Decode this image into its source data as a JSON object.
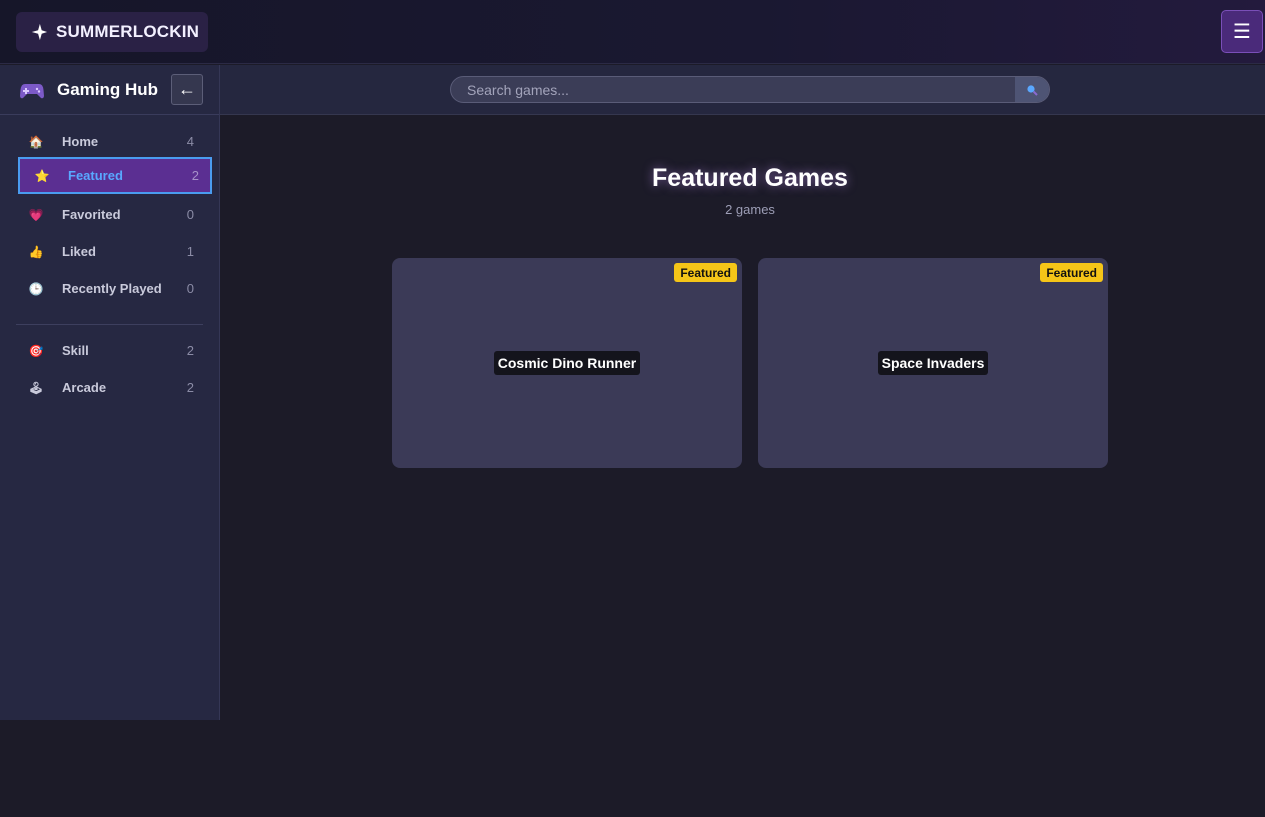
{
  "header": {
    "brand": "SUMMERLOCKIN",
    "brand_icon": "sparkle-icon",
    "menu_icon": "hamburger-icon",
    "menu_glyph": "☰"
  },
  "sidebar": {
    "title": "Gaming Hub",
    "title_icon": "gamepad-icon",
    "collapse_glyph": "←",
    "items": [
      {
        "label": "Home",
        "count": "4",
        "icon": "house-icon",
        "glyph": "🏠"
      },
      {
        "label": "Featured",
        "count": "2",
        "icon": "star-icon",
        "glyph": "⭐",
        "active": true
      },
      {
        "label": "Favorited",
        "count": "0",
        "icon": "heart-icon",
        "glyph": "💗"
      },
      {
        "label": "Liked",
        "count": "1",
        "icon": "thumbs-up-icon",
        "glyph": "👍"
      },
      {
        "label": "Recently Played",
        "count": "0",
        "icon": "clock-icon",
        "glyph": "🕒"
      }
    ],
    "categories": [
      {
        "label": "Skill",
        "count": "2",
        "icon": "target-icon",
        "glyph": "🎯"
      },
      {
        "label": "Arcade",
        "count": "2",
        "icon": "joystick-icon",
        "glyph": "🕹"
      }
    ]
  },
  "search": {
    "placeholder": "Search games...",
    "value": ""
  },
  "main": {
    "title": "Featured Games",
    "subtitle": "2 games",
    "games": [
      {
        "name": "Cosmic Dino Runner",
        "badge": "Featured"
      },
      {
        "name": "Space Invaders",
        "badge": "Featured"
      }
    ]
  },
  "colors": {
    "accent_purple": "#5b2f92",
    "active_border": "#4a9cf0",
    "badge_yellow": "#f5c518",
    "background": "#1c1b28"
  }
}
